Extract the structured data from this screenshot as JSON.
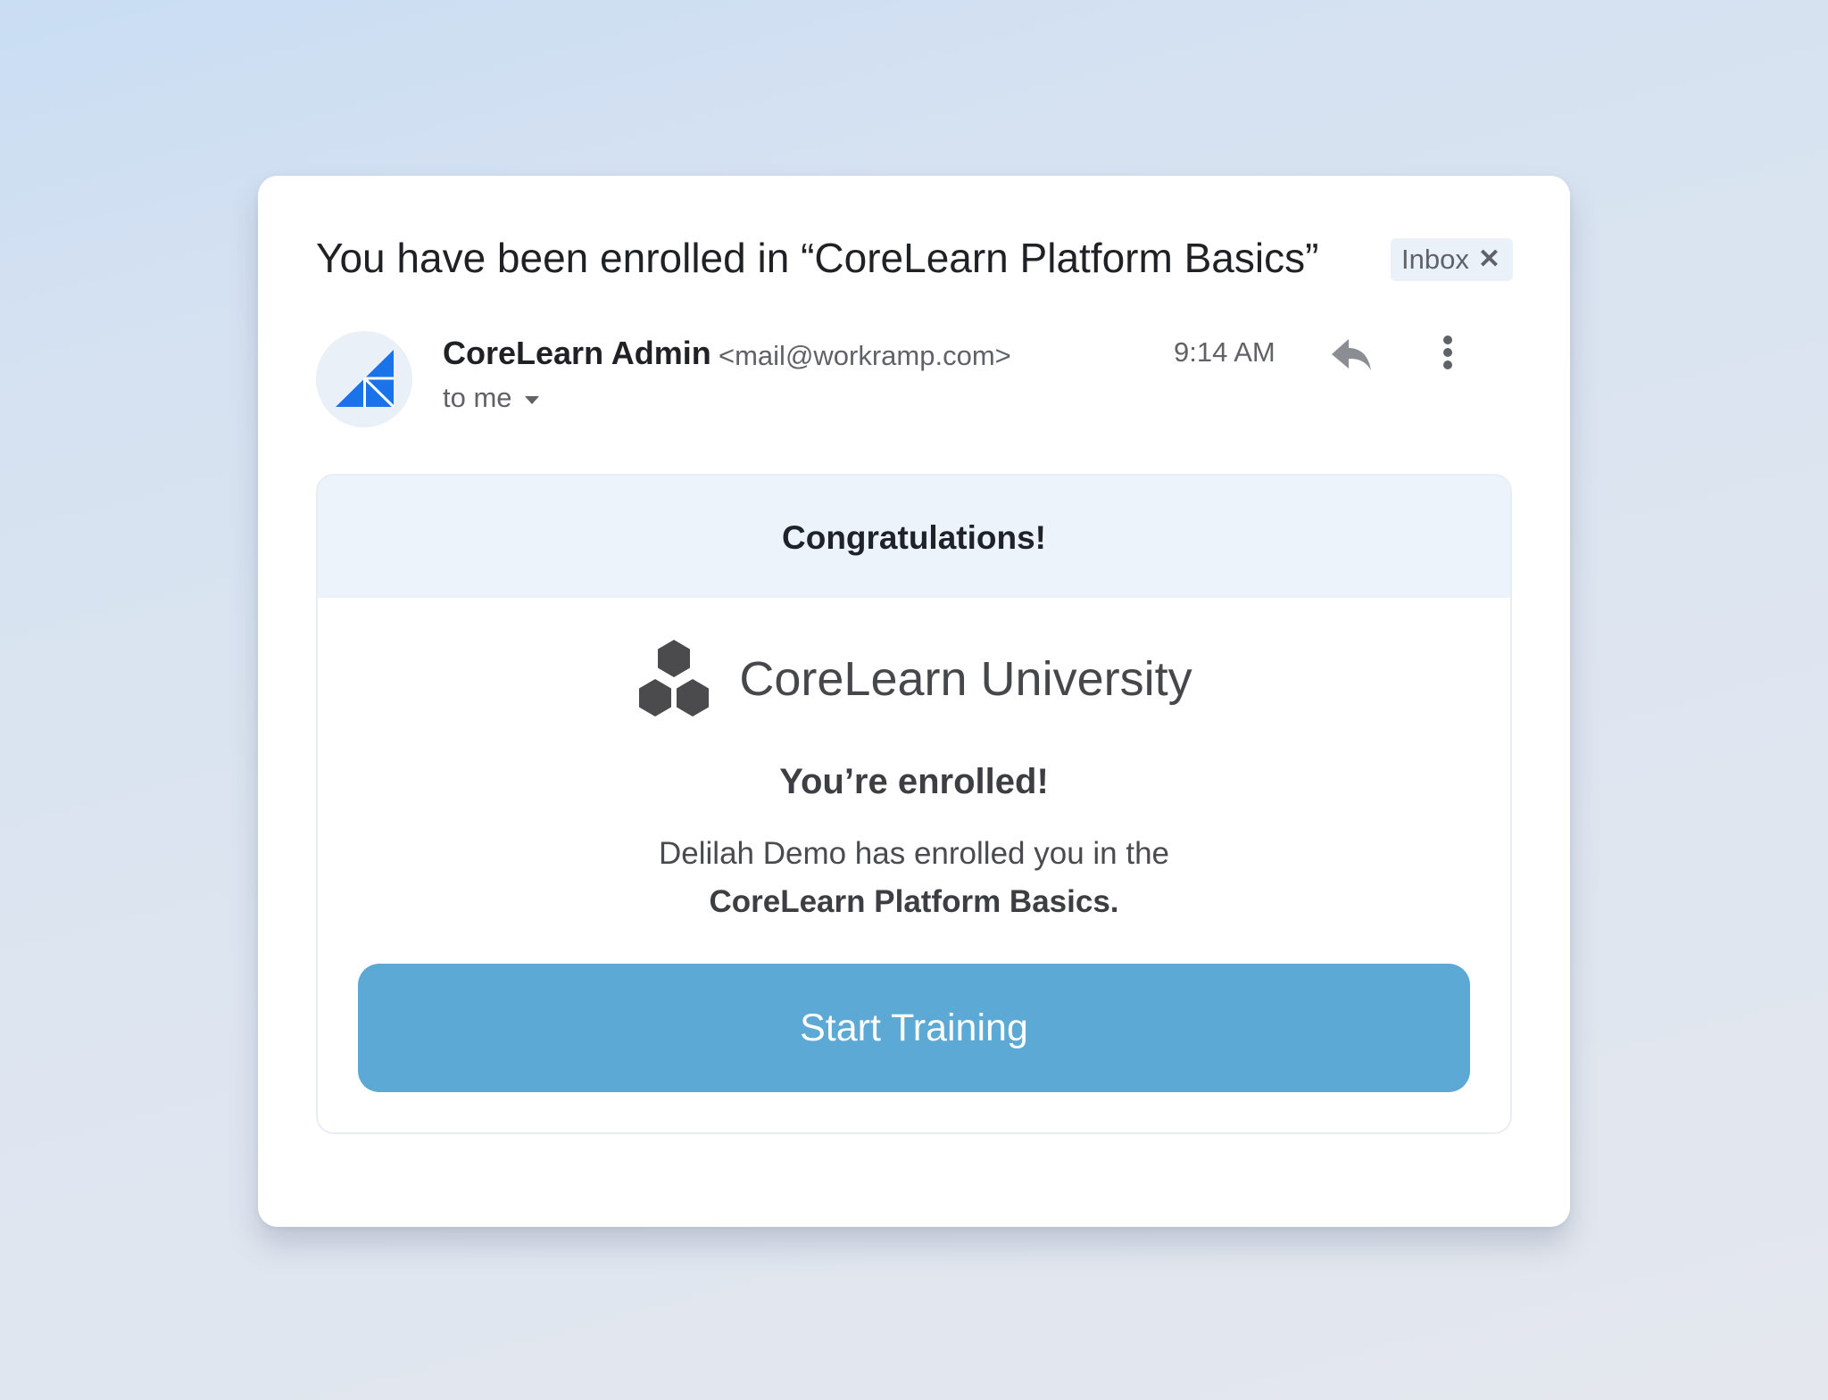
{
  "email": {
    "subject": "You have been enrolled in “CoreLearn Platform Basics”",
    "label_chip": {
      "text": "Inbox",
      "close_glyph": "✕"
    },
    "sender": {
      "name": "CoreLearn Admin",
      "email": "<mail@workramp.com>",
      "avatar_icon": "corelearn-triangle-logo-icon",
      "recipient": "to me"
    },
    "time": "9:14 AM",
    "actions": {
      "reply_icon": "reply-icon",
      "more_icon": "more-vertical-icon"
    }
  },
  "body": {
    "banner": "Congratulations!",
    "brand": {
      "name": "CoreLearn University",
      "logo_icon": "hexagon-cubes-logo-icon"
    },
    "heading": "You’re enrolled!",
    "message_line": "Delilah Demo has enrolled you in the",
    "course_name": "CoreLearn Platform Basics.",
    "cta_label": "Start Training"
  },
  "colors": {
    "cta": "#5ba9d4",
    "banner_bg": "#ecf3fb",
    "avatar_logo": "#1a73e8",
    "brand_logo": "#4b4b4d"
  }
}
